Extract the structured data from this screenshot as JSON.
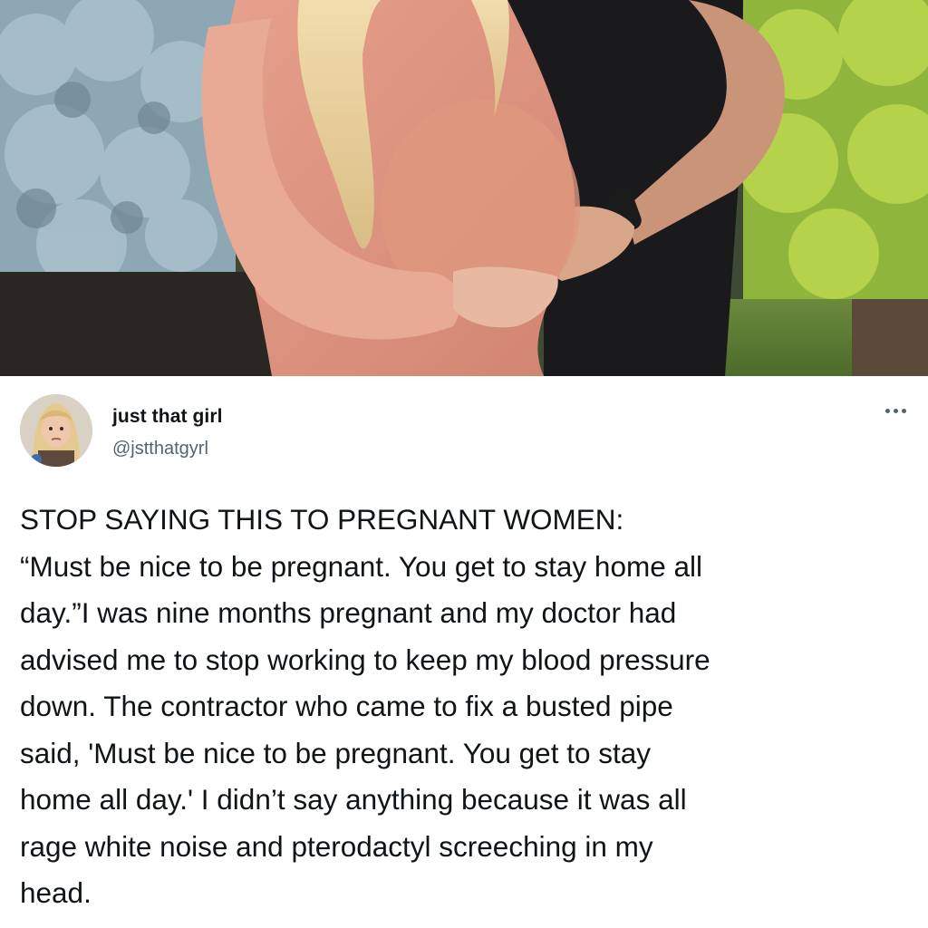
{
  "tweet": {
    "author": {
      "display_name": "just that girl",
      "handle": "@jstthatgyrl",
      "avatar_icon": "user-avatar"
    },
    "more_icon": "more-options-icon",
    "text_lines": [
      "STOP SAYING THIS TO PREGNANT WOMEN:",
      "“Must be nice to be pregnant. You get to stay home all",
      "day.”I was nine months pregnant and my doctor had",
      "advised me to stop working to keep my blood pressure",
      "down. The contractor who came to fix a busted pipe",
      "said, 'Must be nice to be pregnant. You get to stay",
      "home all day.' I didn’t say anything because it was all",
      "rage white noise and pterodactyl screeching in my",
      "head."
    ]
  },
  "colors": {
    "text": "#0f1419",
    "secondary": "#536471",
    "background": "#ffffff"
  }
}
